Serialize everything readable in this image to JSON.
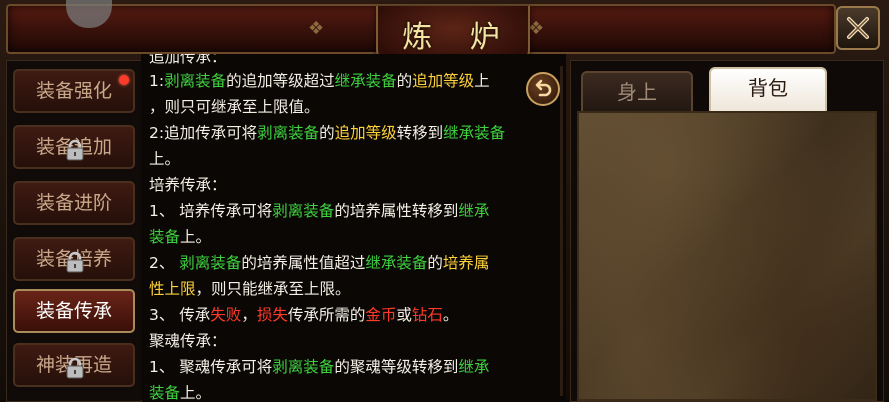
{
  "header": {
    "title": "炼 炉",
    "close_icon": "close-x-icon"
  },
  "sidebar": {
    "items": [
      {
        "label": "装备强化",
        "locked": false,
        "badge": true
      },
      {
        "label": "装备追加",
        "locked": true,
        "badge": false
      },
      {
        "label": "装备进阶",
        "locked": false,
        "badge": false
      },
      {
        "label": "装备培养",
        "locked": true,
        "badge": false
      },
      {
        "label": "装备传承",
        "locked": false,
        "badge": false,
        "active": true
      },
      {
        "label": "神装再造",
        "locked": true,
        "badge": false
      }
    ]
  },
  "tabs": [
    {
      "label": "身上",
      "active": false
    },
    {
      "label": "背包",
      "active": true
    }
  ],
  "info": {
    "partial_top": "追加传承：",
    "lines": [
      [
        {
          "t": "1:"
        },
        {
          "t": "剥离装备",
          "c": "g"
        },
        {
          "t": "的追加等级超过"
        },
        {
          "t": "继承装备",
          "c": "g"
        },
        {
          "t": "的"
        },
        {
          "t": "追加等级",
          "c": "y"
        },
        {
          "t": "上"
        }
      ],
      [
        {
          "t": "，则只可继承至上限值。"
        }
      ],
      [
        {
          "t": "2:追加传承可将"
        },
        {
          "t": "剥离装备",
          "c": "g"
        },
        {
          "t": "的"
        },
        {
          "t": "追加等级",
          "c": "y"
        },
        {
          "t": "转移到"
        },
        {
          "t": "继承装备",
          "c": "g"
        }
      ],
      [
        {
          "t": "上。"
        }
      ],
      [
        {
          "t": "培养传承："
        }
      ],
      [
        {
          "t": "1、 培养传承可将"
        },
        {
          "t": "剥离装备",
          "c": "g"
        },
        {
          "t": "的培养属性转移到"
        },
        {
          "t": "继承",
          "c": "g"
        }
      ],
      [
        {
          "t": "    "
        },
        {
          "t": "装备",
          "c": "g"
        },
        {
          "t": "上。"
        }
      ],
      [
        {
          "t": "2、 "
        },
        {
          "t": "剥离装备",
          "c": "g"
        },
        {
          "t": "的培养属性值超过"
        },
        {
          "t": "继承装备",
          "c": "g"
        },
        {
          "t": "的"
        },
        {
          "t": "培养属",
          "c": "y"
        }
      ],
      [
        {
          "t": "    "
        },
        {
          "t": "性上限",
          "c": "y"
        },
        {
          "t": "，则只能继承至上限。"
        }
      ],
      [
        {
          "t": "3、 传承"
        },
        {
          "t": "失败",
          "c": "r"
        },
        {
          "t": "，"
        },
        {
          "t": "损失",
          "c": "r"
        },
        {
          "t": "传承所需的"
        },
        {
          "t": "金币",
          "c": "r"
        },
        {
          "t": "或"
        },
        {
          "t": "钻石",
          "c": "r"
        },
        {
          "t": "。"
        }
      ],
      [
        {
          "t": "聚魂传承："
        }
      ],
      [
        {
          "t": "1、 聚魂传承可将"
        },
        {
          "t": "剥离装备",
          "c": "g"
        },
        {
          "t": "的聚魂等级转移到"
        },
        {
          "t": "继承",
          "c": "g"
        }
      ],
      [
        {
          "t": "    "
        },
        {
          "t": "装备",
          "c": "g"
        },
        {
          "t": "上。"
        }
      ]
    ]
  }
}
